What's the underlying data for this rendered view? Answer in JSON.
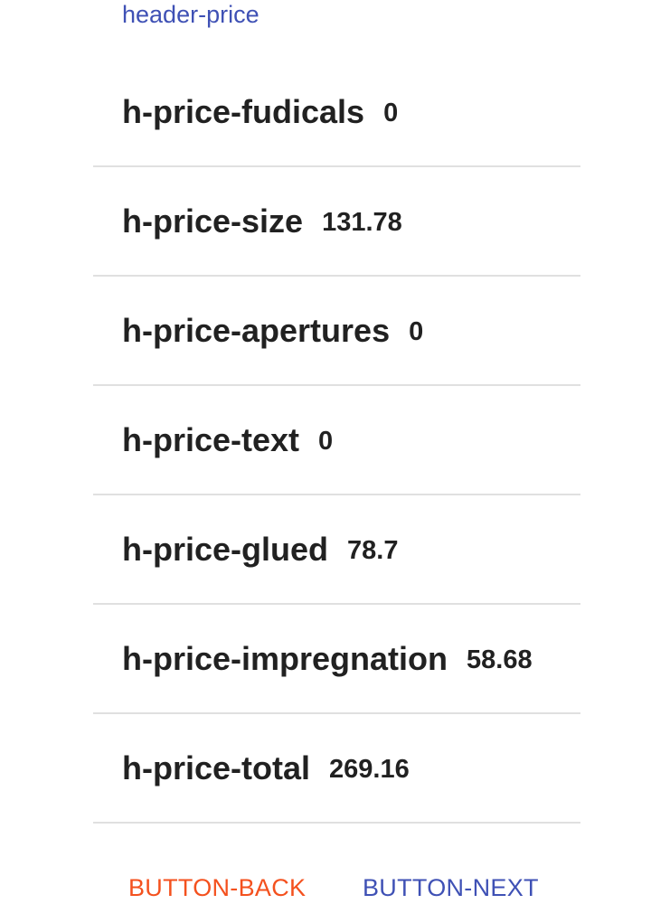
{
  "header": {
    "title": "header-price",
    "link_color": "#3f51b5"
  },
  "prices": [
    {
      "label": "h-price-fudicals",
      "value": "0"
    },
    {
      "label": "h-price-size",
      "value": "131.78"
    },
    {
      "label": "h-price-apertures",
      "value": "0"
    },
    {
      "label": "h-price-text",
      "value": "0"
    },
    {
      "label": "h-price-glued",
      "value": "78.7"
    },
    {
      "label": "h-price-impregnation",
      "value": "58.68"
    },
    {
      "label": "h-price-total",
      "value": "269.16"
    }
  ],
  "actions": {
    "back_label": "BUTTON-BACK",
    "back_color": "#f4511e",
    "next_label": "BUTTON-NEXT",
    "next_color": "#3f51b5"
  }
}
